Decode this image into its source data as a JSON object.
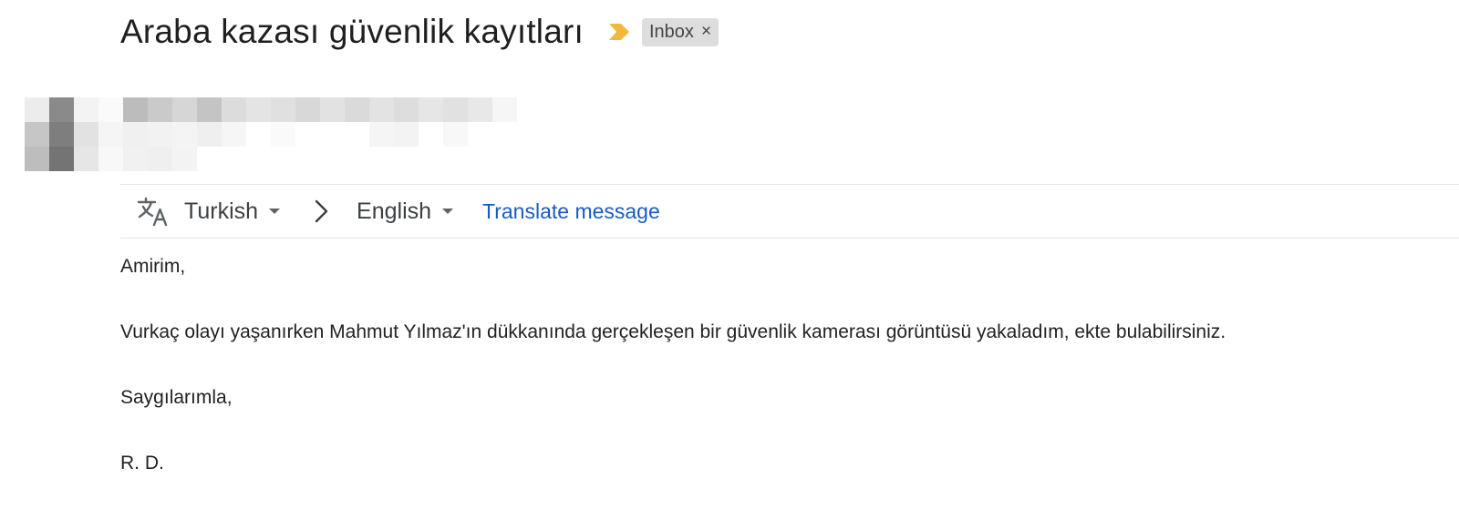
{
  "email": {
    "subject": "Araba kazası güvenlik kayıtları",
    "labels": [
      {
        "name": "Inbox",
        "remove_glyph": "×"
      }
    ],
    "importance_marker": {
      "icon": "importance-arrow-icon",
      "color": "#f2b73d"
    },
    "sender_redacted": true
  },
  "translate_bar": {
    "icon": "translate-icon",
    "source_language": "Turkish",
    "arrow_icon": "chevron-right-icon",
    "target_language": "English",
    "action_label": "Translate message"
  },
  "body": {
    "greeting": "Amirim,",
    "paragraph": "Vurkaç olayı yaşanırken Mahmut Yılmaz'ın dükkanında gerçekleşen bir güvenlik kamerası görüntüsü yakaladım, ekte bulabilirsiniz.",
    "closing": "Saygılarımla,",
    "signature": "R. D."
  },
  "colors": {
    "link": "#1a5bc2",
    "chip_bg": "#dddddd",
    "divider": "#e6e6e6"
  }
}
